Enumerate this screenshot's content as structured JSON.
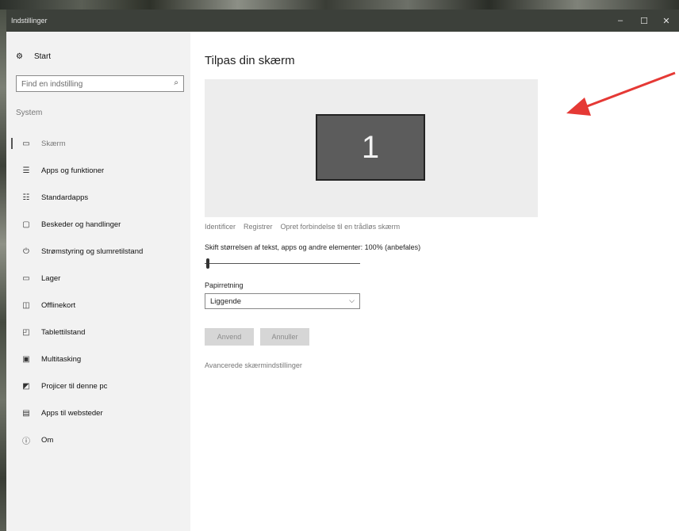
{
  "window": {
    "title": "Indstillinger",
    "controls": {
      "minimize": "–",
      "maximize": "☐",
      "close": "✕"
    }
  },
  "sidebar": {
    "home": {
      "icon": "gear-icon",
      "label": "Start"
    },
    "search": {
      "placeholder": "Find en indstilling",
      "icon": "search-icon"
    },
    "section": "System",
    "items": [
      {
        "label": "Skærm",
        "icon": "monitor-icon",
        "glyph": "▭",
        "active": true
      },
      {
        "label": "Apps og funktioner",
        "icon": "list-icon",
        "glyph": "☰"
      },
      {
        "label": "Standardapps",
        "icon": "default-apps-icon",
        "glyph": "☷"
      },
      {
        "label": "Beskeder og handlinger",
        "icon": "message-icon",
        "glyph": "▢"
      },
      {
        "label": "Strømstyring og slumretilstand",
        "icon": "power-icon",
        "glyph": "⏻"
      },
      {
        "label": "Lager",
        "icon": "storage-icon",
        "glyph": "▭"
      },
      {
        "label": "Offlinekort",
        "icon": "map-icon",
        "glyph": "◫"
      },
      {
        "label": "Tablettilstand",
        "icon": "tablet-icon",
        "glyph": "◰"
      },
      {
        "label": "Multitasking",
        "icon": "multitasking-icon",
        "glyph": "▣"
      },
      {
        "label": "Projicer til denne pc",
        "icon": "project-icon",
        "glyph": "◩"
      },
      {
        "label": "Apps til websteder",
        "icon": "web-apps-icon",
        "glyph": "▤"
      },
      {
        "label": "Om",
        "icon": "info-icon",
        "glyph": "ⓘ"
      }
    ]
  },
  "main": {
    "title": "Tilpas din skærm",
    "monitor_label": "1",
    "links": [
      "Identificer",
      "Registrer",
      "Opret forbindelse til en trådløs skærm"
    ],
    "scale_label": "Skift størrelsen af tekst, apps og andre elementer: 100% (anbefales)",
    "scale_value_fraction": 0.0,
    "orientation_label": "Papirretning",
    "orientation_value": "Liggende",
    "apply_button": "Anvend",
    "cancel_button": "Annuller",
    "advanced_link": "Avancerede skærmindstillinger"
  },
  "colors": {
    "titlebar": "#3c403a",
    "sidebar_bg": "#f2f2f2",
    "annotation_arrow": "#e53935"
  }
}
